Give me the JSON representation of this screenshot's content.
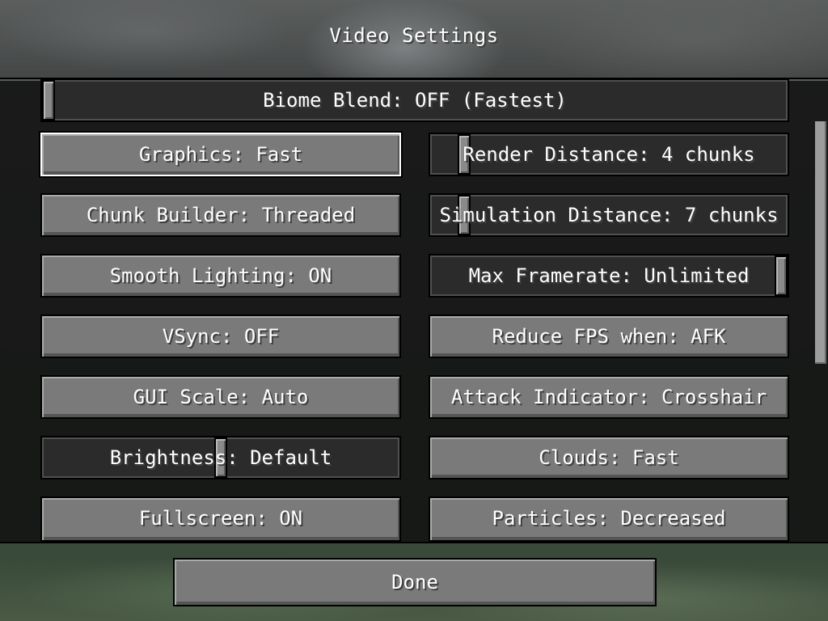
{
  "screen": {
    "title": "Video Settings"
  },
  "options": {
    "biome_blend": {
      "label": "Biome Blend: OFF (Fastest)",
      "level": 0
    },
    "graphics": "Graphics: Fast",
    "render_distance": {
      "label": "Render Distance: 4 chunks",
      "level": 0.08
    },
    "chunk_builder": "Chunk Builder: Threaded",
    "simulation_distance": {
      "label": "Simulation Distance: 7 chunks",
      "level": 0.08
    },
    "smooth_lighting": "Smooth Lighting: ON",
    "max_framerate": {
      "label": "Max Framerate: Unlimited",
      "level": 1
    },
    "vsync": "VSync: OFF",
    "reduce_fps": "Reduce FPS when: AFK",
    "gui_scale": "GUI Scale: Auto",
    "attack_indicator": "Attack Indicator: Crosshair",
    "brightness": {
      "label": "Brightness: Default",
      "level": 0.5
    },
    "clouds": "Clouds: Fast",
    "fullscreen": "Fullscreen: ON",
    "particles": "Particles: Decreased"
  },
  "footer": {
    "done_label": "Done"
  },
  "colors": {
    "button": "#7a7a7a",
    "slider_track": "#2b2b2b",
    "text": "#ffffff"
  }
}
